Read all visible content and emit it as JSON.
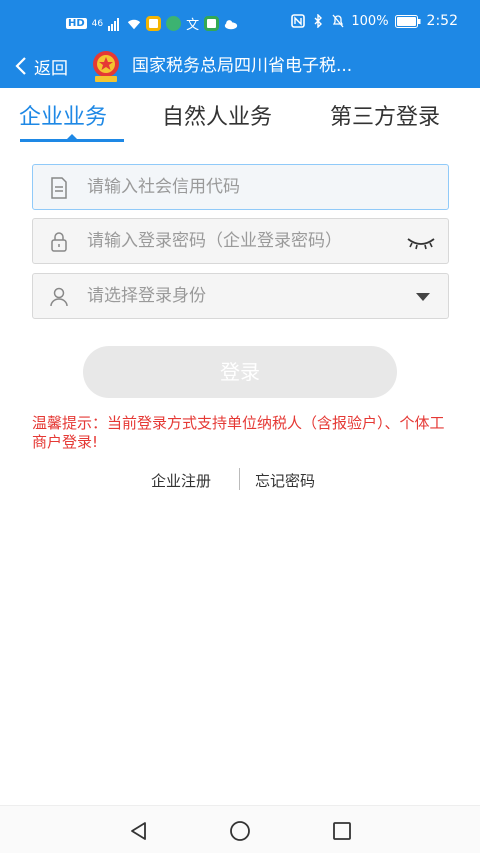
{
  "status_bar": {
    "left_labels": [
      "HD",
      "46"
    ],
    "battery_text": "100%",
    "time": "2:52"
  },
  "nav": {
    "back_label": "返回",
    "title": "国家税务总局四川省电子税..."
  },
  "tabs": [
    {
      "label": "企业业务",
      "active": true
    },
    {
      "label": "自然人业务",
      "active": false
    },
    {
      "label": "第三方登录",
      "active": false
    }
  ],
  "form": {
    "credit_code_placeholder": "请输入社会信用代码",
    "password_placeholder": "请输入登录密码（企业登录密码）",
    "identity_placeholder": "请选择登录身份"
  },
  "login_label": "登录",
  "notice": "温馨提示：当前登录方式支持单位纳税人（含报验户）、个体工商户登录!",
  "links": {
    "register": "企业注册",
    "forgot": "忘记密码"
  },
  "colors": {
    "primary": "#1e88e5",
    "notice": "#e53935",
    "button_disabled": "#e8e8e8"
  }
}
